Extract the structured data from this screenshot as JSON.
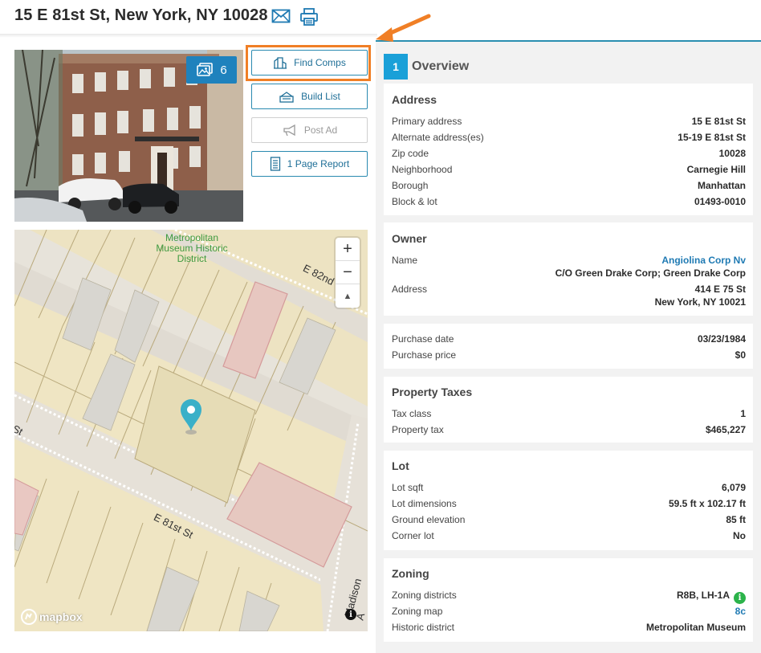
{
  "header": {
    "title": "15 E 81st St, New York, NY 10028",
    "icons": [
      "envelope-icon",
      "printer-icon"
    ]
  },
  "photo": {
    "count": "6"
  },
  "actions": {
    "find_comps": "Find Comps",
    "build_list": "Build List",
    "post_ad": "Post Ad",
    "page_report": "1 Page Report"
  },
  "map": {
    "district_label": [
      "Metropolitan",
      "Museum Historic",
      "District"
    ],
    "street_81": "E 81st St",
    "street_82": "E 82nd",
    "street_madison": "Madison A",
    "street_fragment": "St",
    "zoom_in": "+",
    "zoom_out": "−",
    "compass": "▲",
    "attribution": "mapbox",
    "info": "i"
  },
  "overview": {
    "number": "1",
    "title": "Overview",
    "address": {
      "title": "Address",
      "rows": [
        {
          "label": "Primary address",
          "value": "15 E 81st St"
        },
        {
          "label": "Alternate address(es)",
          "value": "15-19 E 81st St"
        },
        {
          "label": "Zip code",
          "value": "10028"
        },
        {
          "label": "Neighborhood",
          "value": "Carnegie Hill"
        },
        {
          "label": "Borough",
          "value": "Manhattan"
        },
        {
          "label": "Block & lot",
          "value": "01493-0010"
        }
      ]
    },
    "owner": {
      "title": "Owner",
      "name_label": "Name",
      "name_value": "Angiolina Corp Nv",
      "name_sub": "C/O Green Drake Corp; Green Drake Corp",
      "address_label": "Address",
      "address_line1": "414 E 75 St",
      "address_line2": "New York, NY 10021"
    },
    "purchase": {
      "rows": [
        {
          "label": "Purchase date",
          "value": "03/23/1984"
        },
        {
          "label": "Purchase price",
          "value": "$0"
        }
      ]
    },
    "taxes": {
      "title": "Property Taxes",
      "rows": [
        {
          "label": "Tax class",
          "value": "1"
        },
        {
          "label": "Property tax",
          "value": "$465,227"
        }
      ]
    },
    "lot": {
      "title": "Lot",
      "rows": [
        {
          "label": "Lot sqft",
          "value": "6,079"
        },
        {
          "label": "Lot dimensions",
          "value": "59.5 ft x 102.17 ft"
        },
        {
          "label": "Ground elevation",
          "value": "85 ft"
        },
        {
          "label": "Corner lot",
          "value": "No"
        }
      ]
    },
    "zoning": {
      "title": "Zoning",
      "rows": [
        {
          "label": "Zoning districts",
          "value": "R8B, LH-1A"
        },
        {
          "label": "Zoning map",
          "value": "8c"
        },
        {
          "label": "Historic district",
          "value": "Metropolitan Museum"
        }
      ],
      "info": "i"
    }
  },
  "colors": {
    "accent": "#1f7ab3",
    "highlight": "#f07f26",
    "overview_badge": "#1aa0d8",
    "info_green": "#2bb34a"
  }
}
